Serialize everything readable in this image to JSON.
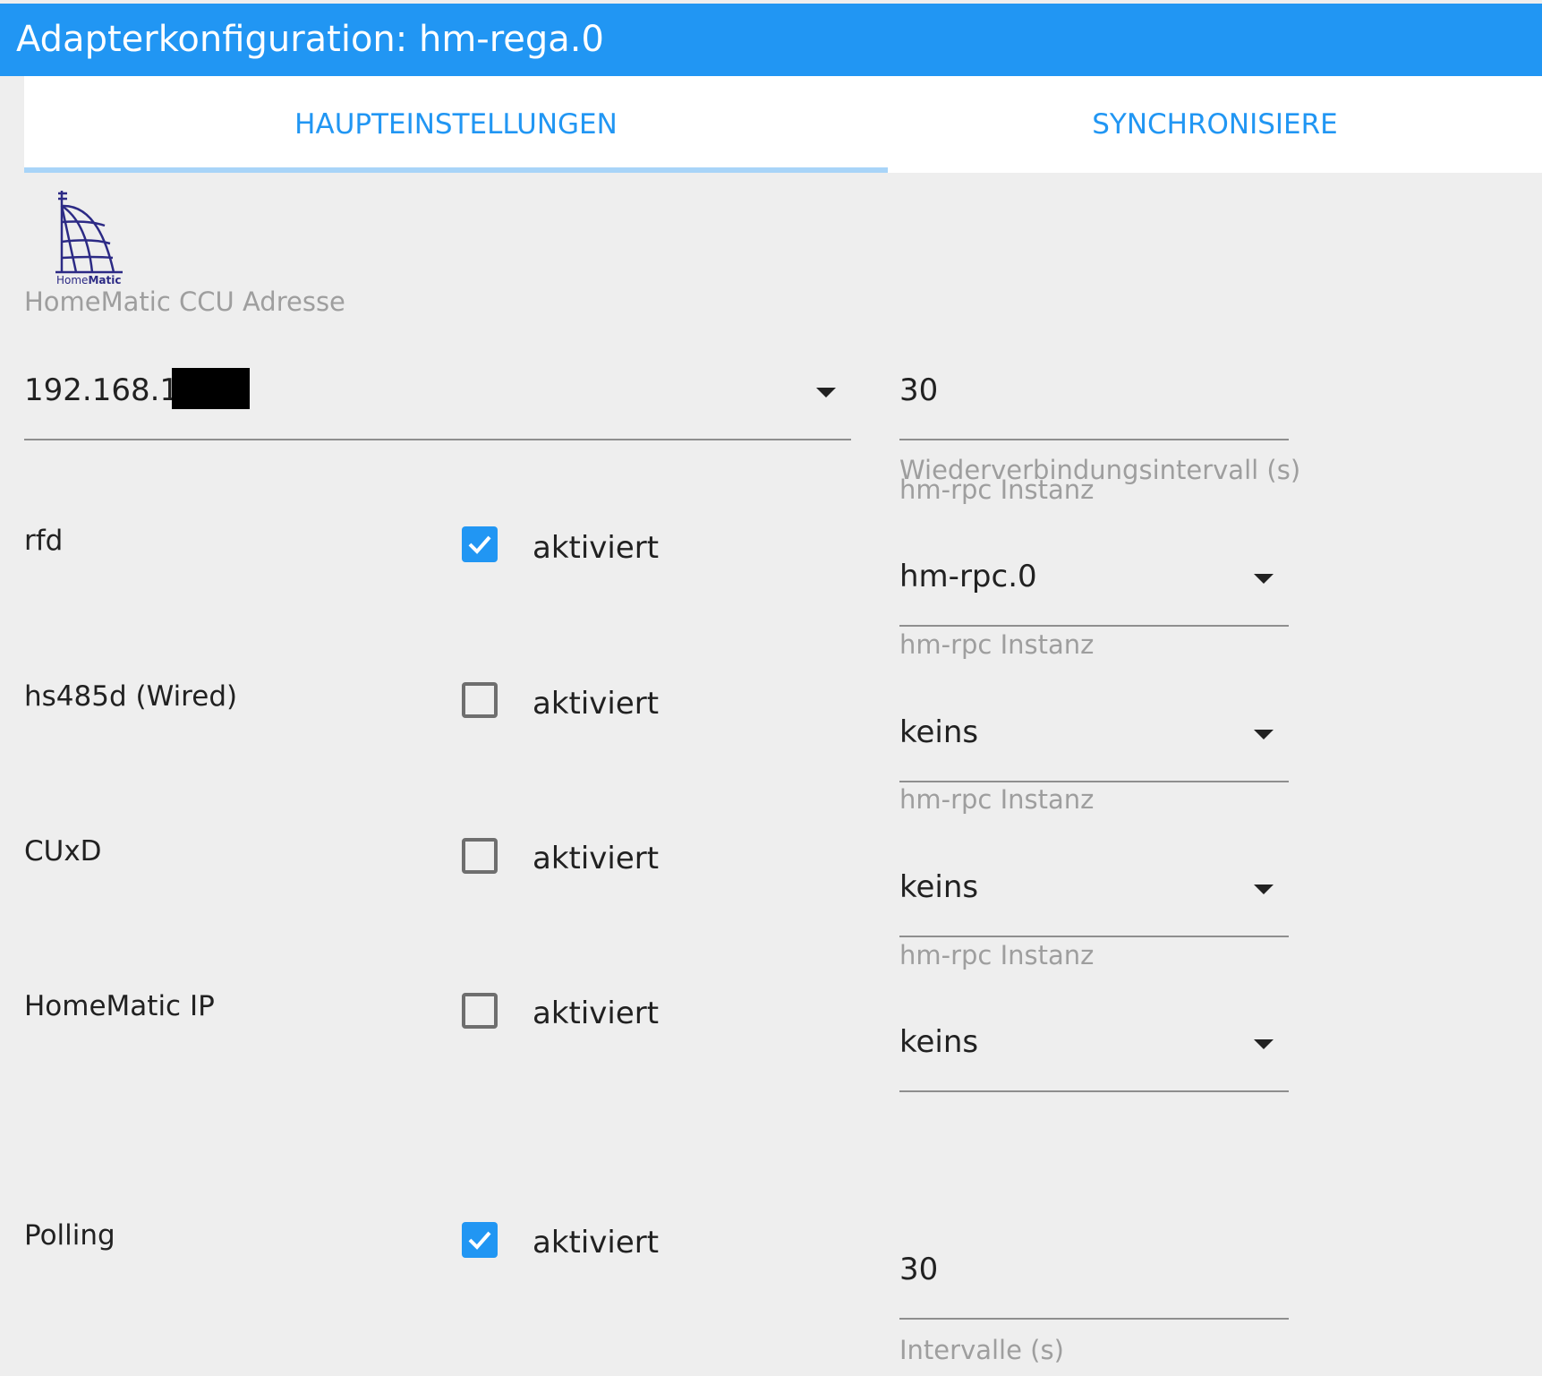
{
  "header": {
    "title": "Adapterkonfiguration: hm-rega.0"
  },
  "tabs": [
    {
      "label": "HAUPTEINSTELLUNGEN",
      "active": true
    },
    {
      "label": "SYNCHRONISIERE",
      "active": false
    }
  ],
  "logo": {
    "text_home": "Home",
    "text_matic": "Matic"
  },
  "ccu": {
    "label": "HomeMatic CCU Adresse",
    "value": "192.168.17"
  },
  "reconnect": {
    "value": "30",
    "label": "Wiederverbindungsintervall (s)",
    "overlap_label": "hm-rpc Instanz"
  },
  "rows": [
    {
      "name": "rfd",
      "checked": true,
      "checkbox_label": "aktiviert",
      "instance_value": "hm-rpc.0",
      "instance_label": "hm-rpc Instanz"
    },
    {
      "name": "hs485d (Wired)",
      "checked": false,
      "checkbox_label": "aktiviert",
      "instance_value": "keins",
      "instance_label": "hm-rpc Instanz"
    },
    {
      "name": "CUxD",
      "checked": false,
      "checkbox_label": "aktiviert",
      "instance_value": "keins",
      "instance_label": "hm-rpc Instanz"
    },
    {
      "name": "HomeMatic IP",
      "checked": false,
      "checkbox_label": "aktiviert",
      "instance_value": "keins"
    }
  ],
  "polling": {
    "name": "Polling",
    "checked": true,
    "checkbox_label": "aktiviert",
    "interval_value": "30",
    "interval_label": "Intervalle (s)"
  },
  "colors": {
    "primary": "#2196f3",
    "background": "#eeeeee",
    "muted_text": "#9e9e9e",
    "tab_indicator": "#a8d4f8"
  }
}
